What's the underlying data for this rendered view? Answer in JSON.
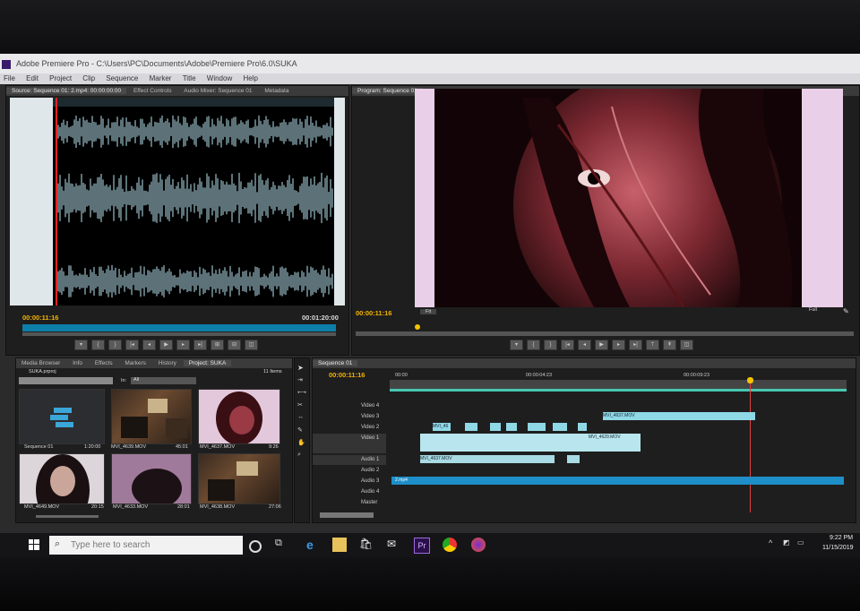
{
  "window": {
    "title": "Adobe Premiere Pro - C:\\Users\\PC\\Documents\\Adobe\\Premiere Pro\\6.0\\SUKA",
    "menu": [
      "File",
      "Edit",
      "Project",
      "Clip",
      "Sequence",
      "Marker",
      "Title",
      "Window",
      "Help"
    ]
  },
  "source_panel": {
    "tabs": [
      "Source: Sequence 01: 2.mp4: 00:00:00:00",
      "Effect Controls",
      "Audio Mixer: Sequence 01",
      "Metadata"
    ],
    "timecode": "00:00:11:16",
    "duration": "00:01:20:00"
  },
  "program_panel": {
    "tab": "Program: Sequence 01",
    "timecode": "00:00:11:16",
    "zoom": "Fit",
    "quality": "Full"
  },
  "project_panel": {
    "tabs": [
      "Media Browser",
      "Info",
      "Effects",
      "Markers",
      "History",
      "Project: SUKA"
    ],
    "project_file": "SUKA.prproj",
    "item_count": "11 Items",
    "in_label": "In:",
    "in_value": "All",
    "items": [
      {
        "name": "Sequence 01",
        "duration": "1:20:00"
      },
      {
        "name": "MVI_4639.MOV",
        "duration": "45:01"
      },
      {
        "name": "MVI_4637.MOV",
        "duration": "9:26"
      },
      {
        "name": "MVI_4649.MOV",
        "duration": "20:15"
      },
      {
        "name": "MVI_4633.MOV",
        "duration": "28:01"
      },
      {
        "name": "MVI_4638.MOV",
        "duration": "27:06"
      }
    ]
  },
  "timeline": {
    "tab": "Sequence 01",
    "timecode": "00:00:11:16",
    "ruler": [
      "00:00",
      "00:00:04:23",
      "00:00:09:23"
    ],
    "tracks": [
      "Video 4",
      "Video 3",
      "Video 2",
      "Video 1",
      "Audio 1",
      "Audio 2",
      "Audio 3",
      "Audio 4",
      "Master"
    ],
    "clips": {
      "v3_label": "MVI_4637.MOV",
      "v2_label": "MVI_46",
      "v1_label": "MVI_4629.MOV",
      "a1_label": "MVI_4637.MOV",
      "a3_label": "2.mp4"
    }
  },
  "taskbar": {
    "search_placeholder": "Type here to search",
    "time": "9:22 PM",
    "date": "11/15/2019",
    "pr_label": "Pr"
  }
}
